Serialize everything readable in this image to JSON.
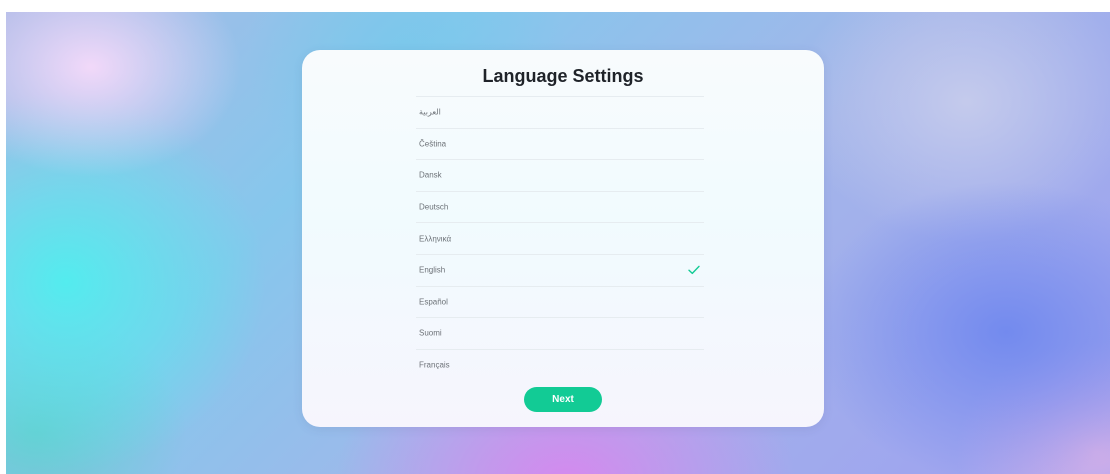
{
  "dialog": {
    "title": "Language Settings",
    "next_label": "Next"
  },
  "languages": [
    {
      "label": "العربية",
      "selected": false
    },
    {
      "label": "Čeština",
      "selected": false
    },
    {
      "label": "Dansk",
      "selected": false
    },
    {
      "label": "Deutsch",
      "selected": false
    },
    {
      "label": "Ελληνικά",
      "selected": false
    },
    {
      "label": "English",
      "selected": true
    },
    {
      "label": "Español",
      "selected": false
    },
    {
      "label": "Suomi",
      "selected": false
    },
    {
      "label": "Français",
      "selected": false
    }
  ],
  "icons": {
    "selected_indicator": "check-icon"
  },
  "colors": {
    "accent": "#12cb95",
    "title_text": "#1f2329",
    "item_text": "#6d7278",
    "divider": "#e6ecf0"
  }
}
